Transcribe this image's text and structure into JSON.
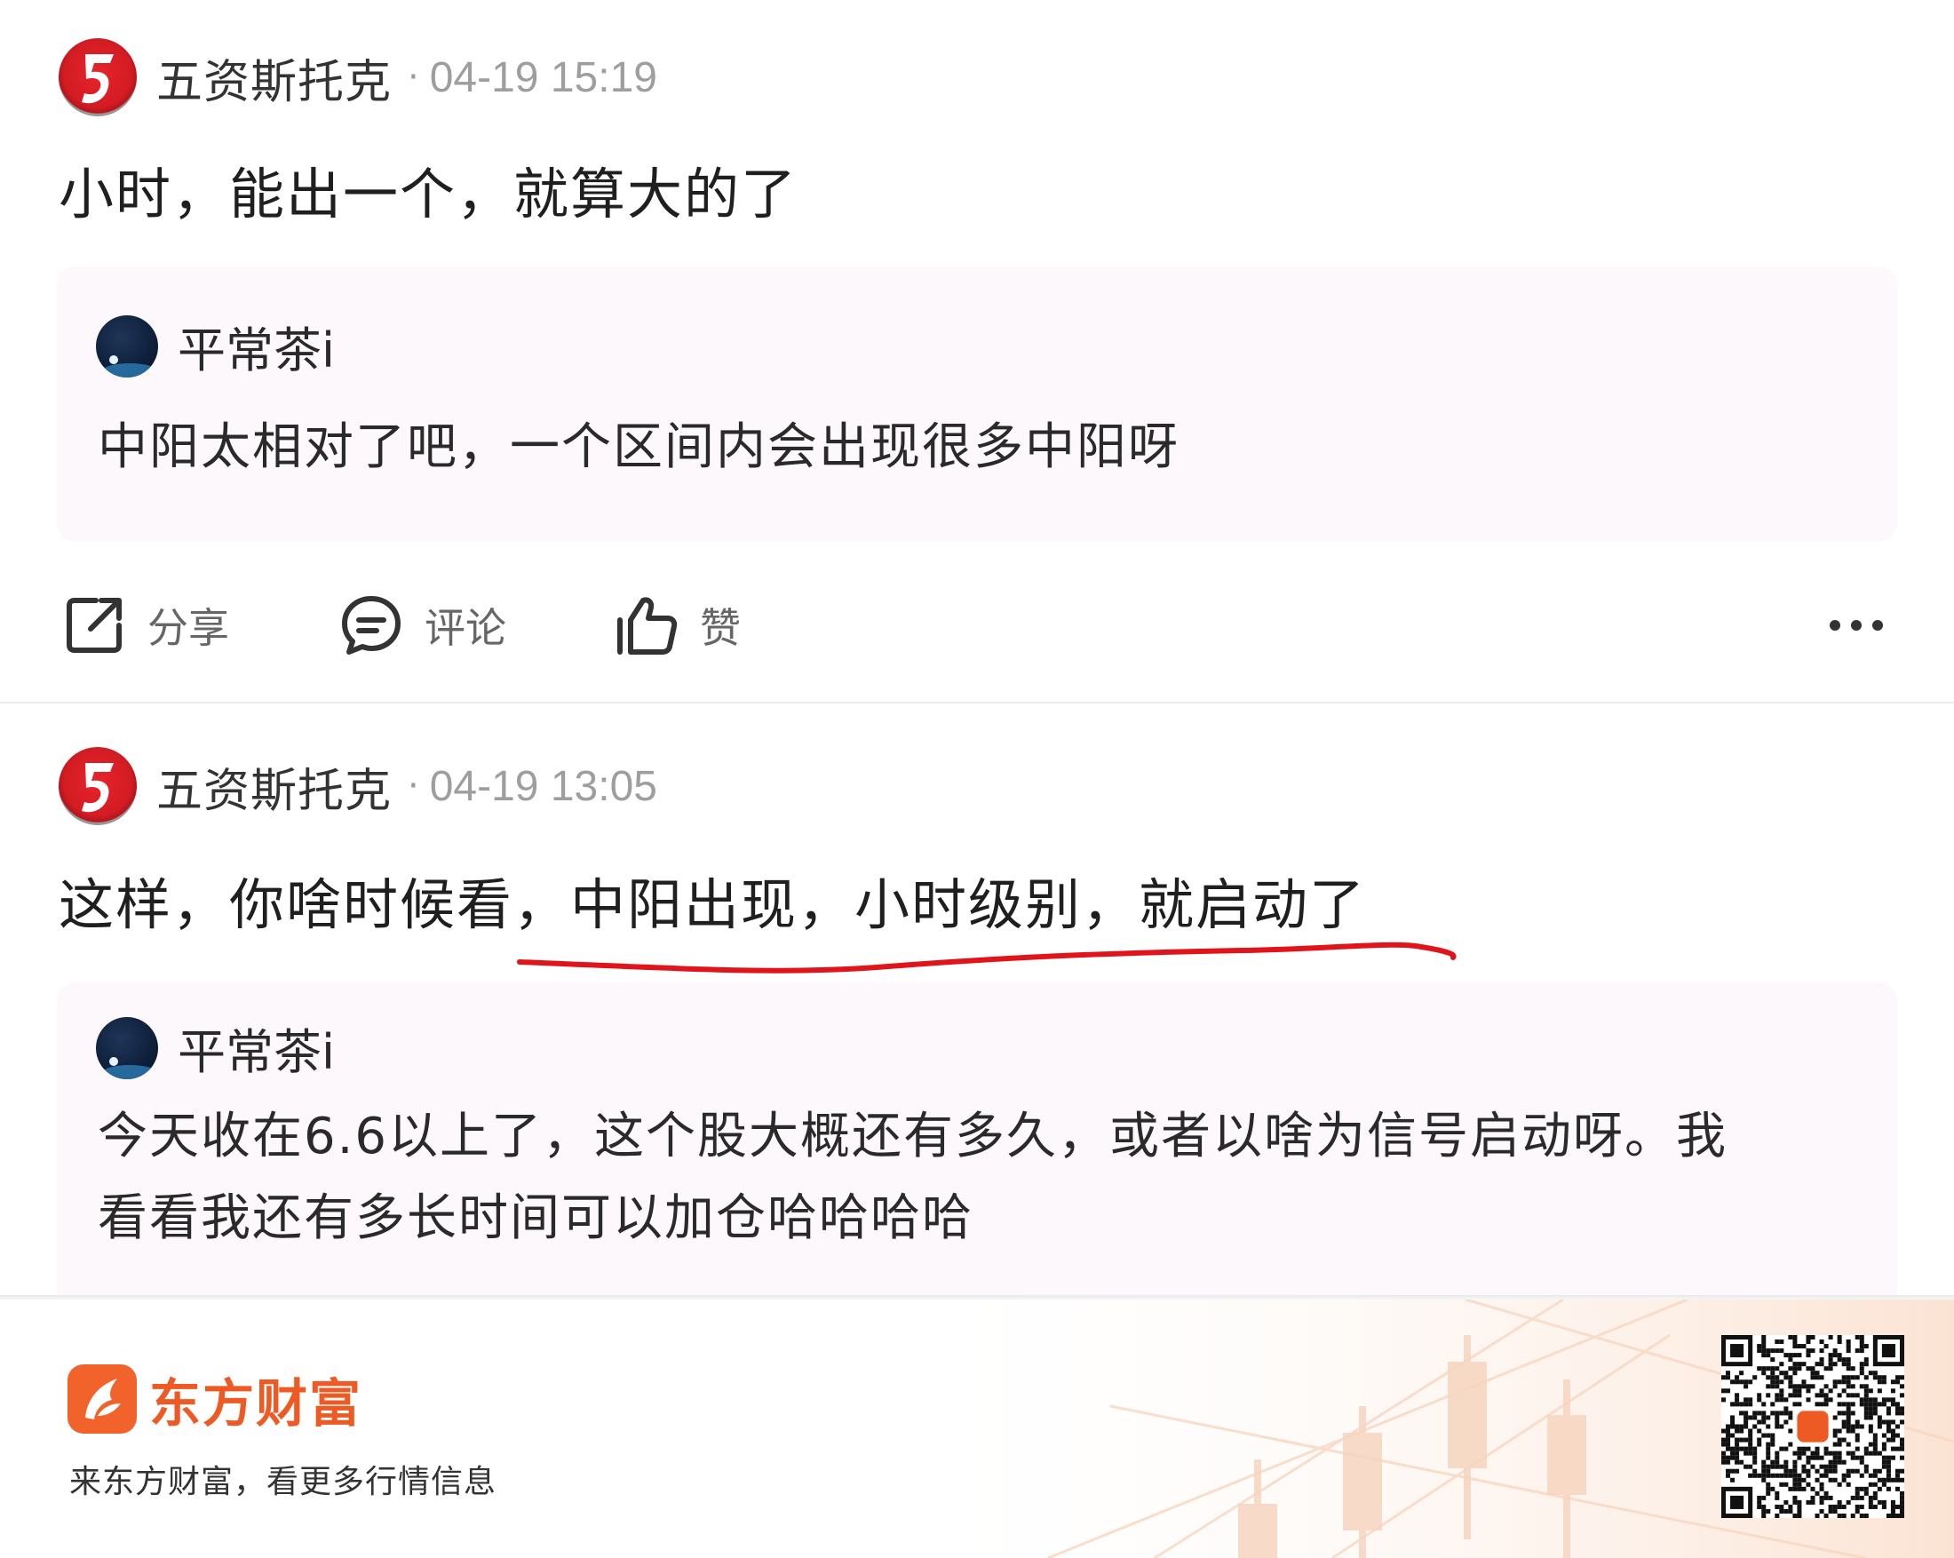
{
  "posts": [
    {
      "author": "五资斯托克",
      "separator": "·",
      "time": "04-19 15:19",
      "text": "小时，能出一个，就算大的了",
      "quote": {
        "author": "平常茶i",
        "text_lines": [
          "中阳太相对了吧，一个区间内会出现很多中阳呀"
        ]
      },
      "actions": {
        "share": "分享",
        "comment": "评论",
        "like": "赞"
      }
    },
    {
      "author": "五资斯托克",
      "separator": "·",
      "time": "04-19 13:05",
      "text": "这样，你啥时候看，中阳出现，小时级别，就启动了",
      "quote": {
        "author": "平常茶i",
        "text_lines": [
          "今天收在6.6以上了，这个股大概还有多久，或者以啥为信号启动呀。我",
          "看看我还有多长时间可以加仓哈哈哈哈"
        ]
      }
    }
  ],
  "annotation": {
    "color": "#e0151c"
  },
  "footer": {
    "brand": "东方财富",
    "slogan": "来东方财富，看更多行情信息",
    "brand_color": "#ee5a23"
  }
}
